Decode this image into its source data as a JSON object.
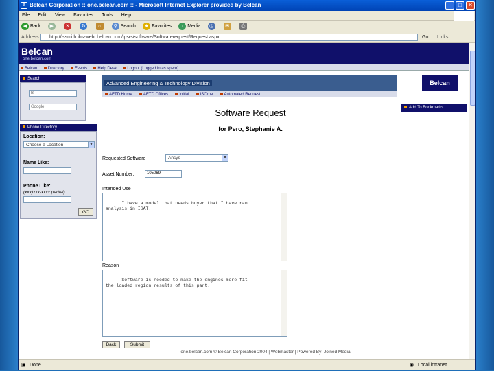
{
  "window": {
    "title": "Belcan Corporation :: one.belcan.com :: - Microsoft Internet Explorer provided by Belcan",
    "minimize": "_",
    "maximize": "□",
    "close": "✕"
  },
  "menu": [
    "File",
    "Edit",
    "View",
    "Favorites",
    "Tools",
    "Help"
  ],
  "toolbar": {
    "back": "Back",
    "search": "Search",
    "favorites": "Favorites",
    "media": "Media"
  },
  "address": {
    "label": "Address",
    "url": "http://issmith.ibs-webt.belcan.com/ipsrs/software/Softwarerequest/Request.aspx",
    "go": "Go",
    "links": "Links"
  },
  "site": {
    "logo": "Belcan",
    "logo_sub": "one.belcan.com",
    "nav": [
      "Belcan",
      "Directory",
      "Events",
      "Help Desk",
      "Logout (Logged in as spero)"
    ]
  },
  "search_panel": {
    "header": "Search",
    "field1": "B",
    "field2": "Google"
  },
  "phone_panel": {
    "header": "Phone Directory",
    "location_label": "Location:",
    "location_value": "Choose a Location",
    "name_label": "Name Like:",
    "phone_label": "Phone Like:",
    "phone_hint": "(xxx)xxx-xxxx partial)",
    "go_button": "GO"
  },
  "division": {
    "title": "Advanced Engineering & Technology Division",
    "tabs": [
      "AETD Home",
      "AETD Offices",
      "Initial",
      "ISOme",
      "Automated Request"
    ]
  },
  "badge": "Belcan",
  "bookmark": "Add To Bookmarks",
  "form": {
    "title": "Software Request",
    "subtitle": "for Pero, Stephanie A.",
    "software_label": "Requested Software",
    "software_value": "Ansys",
    "asset_label": "Asset Number:",
    "asset_value": "105069",
    "intended_label": "Intended Use",
    "intended_text": "I have a model that needs buyer that I have ran\nanalysis in ISAT.",
    "reason_label": "Reason",
    "reason_text": "Software is needed to make the engines more fit\nthe loaded region results of this part.",
    "back_button": "Back",
    "submit_button": "Submit"
  },
  "footer": "one.belcan.com  © Belcan Corporation 2004  |  Webmaster  |  Powered By: Joined Media",
  "status": {
    "left": "Done",
    "right": "Local intranet"
  }
}
